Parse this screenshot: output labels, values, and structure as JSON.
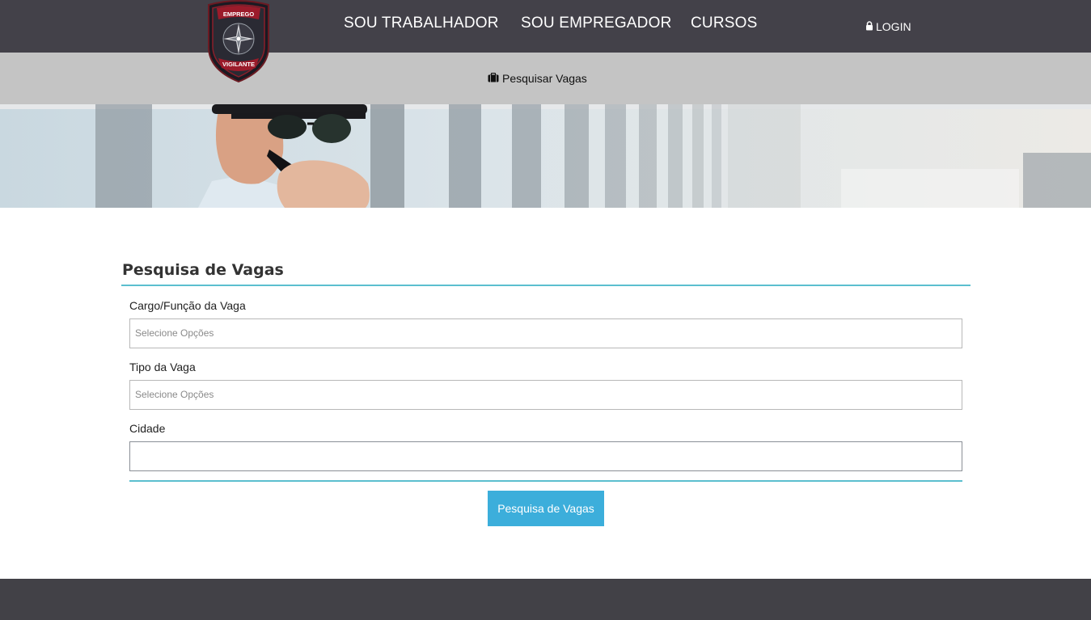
{
  "logo": {
    "top_text": "EMPREGO",
    "bottom_text": "VIGILANTE"
  },
  "nav": {
    "items": [
      {
        "label": "SOU TRABALHADOR"
      },
      {
        "label": "SOU EMPREGADOR"
      },
      {
        "label": "CURSOS"
      }
    ],
    "login_label": "LOGIN"
  },
  "subnav": {
    "search_jobs_label": "Pesquisar Vagas",
    "icon": "briefcase-icon"
  },
  "form": {
    "title": "Pesquisa de Vagas",
    "fields": [
      {
        "label": "Cargo/Função da Vaga",
        "placeholder": "Selecione Opções"
      },
      {
        "label": "Tipo da Vaga",
        "placeholder": "Selecione Opções"
      },
      {
        "label": "Cidade",
        "value": ""
      }
    ],
    "submit_label": "Pesquisa de Vagas"
  },
  "colors": {
    "topbar": "#434149",
    "subbar": "#c4c4c4",
    "accent_rule": "#5bbfcf",
    "button": "#3caedb",
    "footer": "#424147"
  }
}
